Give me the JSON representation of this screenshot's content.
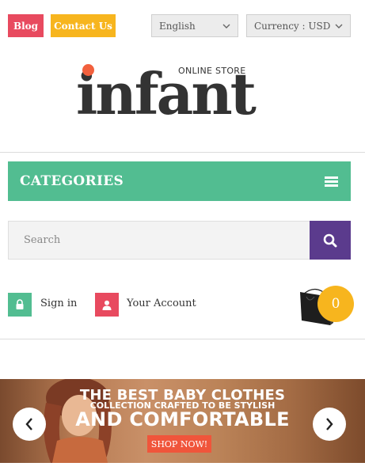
{
  "topbar": {
    "blog_label": "Blog",
    "contact_label": "Contact Us",
    "language_selected": "English",
    "currency_selected": "Currency : USD"
  },
  "logo": {
    "tagline": "ONLINE STORE",
    "brand": "infant"
  },
  "nav": {
    "categories_label": "CATEGORIES"
  },
  "search": {
    "placeholder": "Search"
  },
  "account": {
    "signin_label": "Sign in",
    "account_label": "Your Account"
  },
  "cart": {
    "count": "0"
  },
  "banner": {
    "line1": "THE BEST BABY CLOTHES",
    "line2": "COLLECTION CRAFTED TO BE STYLISH",
    "line3": "AND COMFORTABLE",
    "cta": "SHOP NOW!"
  },
  "colors": {
    "blog": "#e84a5f",
    "contact": "#f7b51e",
    "categories": "#52bd91",
    "search_button": "#5b3b8d",
    "cart_badge": "#f7b51e",
    "cta": "#f0553b"
  }
}
